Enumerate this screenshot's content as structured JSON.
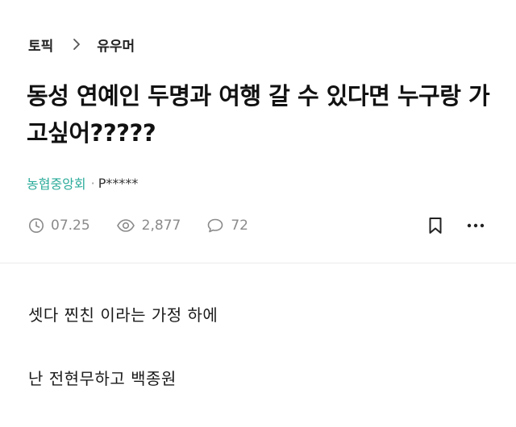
{
  "breadcrumb": {
    "topic": "토픽",
    "category": "유우머"
  },
  "post": {
    "title": "동성 연예인 두명과 여행 갈 수 있다면 누구랑 가고싶어?????",
    "company": "농협중앙회",
    "separator": "·",
    "author": "P*****",
    "date": "07.25",
    "views": "2,877",
    "comments": "72",
    "body": [
      "셋다 찐친 이라는 가정 하에",
      "난 전현무하고 백종원"
    ]
  },
  "colors": {
    "company": "#2bab9a",
    "meta_gray": "#8a8a8a"
  },
  "icons": {
    "date": "clock-icon",
    "views": "eye-icon",
    "comments": "speech-bubble-icon",
    "bookmark": "bookmark-icon",
    "more": "more-dots-icon",
    "breadcrumb_sep": "chevron-right-icon"
  }
}
